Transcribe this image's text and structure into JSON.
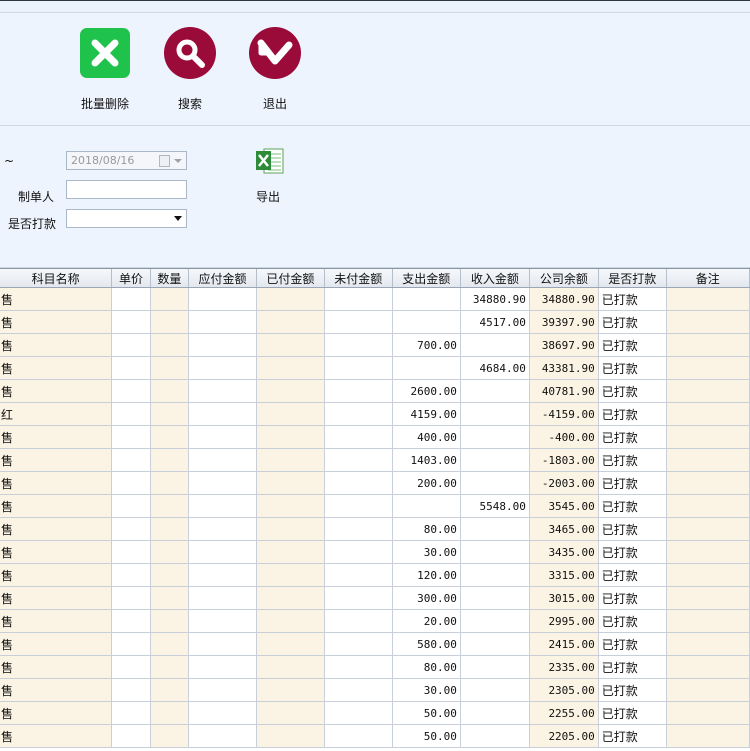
{
  "toolbar": {
    "batch_delete": "批量删除",
    "search": "搜索",
    "exit": "退出"
  },
  "form": {
    "tilde": "~",
    "date_value": "2018/08/16",
    "creator_label": "制单人",
    "creator_value": "",
    "paid_label": "是否打款",
    "paid_value": "",
    "export_label": "导出"
  },
  "grid": {
    "columns": [
      "科目名称",
      "单价",
      "数量",
      "应付金额",
      "已付金额",
      "未付金额",
      "支出金额",
      "收入金额",
      "公司余额",
      "是否打款",
      "备注"
    ],
    "rows": [
      {
        "subject": "售",
        "expense": "",
        "income": "34880.90",
        "balance": "34880.90",
        "paid": "已打款"
      },
      {
        "subject": "售",
        "expense": "",
        "income": "4517.00",
        "balance": "39397.90",
        "paid": "已打款"
      },
      {
        "subject": "售",
        "expense": "700.00",
        "income": "",
        "balance": "38697.90",
        "paid": "已打款"
      },
      {
        "subject": "售",
        "expense": "",
        "income": "4684.00",
        "balance": "43381.90",
        "paid": "已打款"
      },
      {
        "subject": "售",
        "expense": "2600.00",
        "income": "",
        "balance": "40781.90",
        "paid": "已打款"
      },
      {
        "subject": "红",
        "expense": "4159.00",
        "income": "",
        "balance": "-4159.00",
        "paid": "已打款"
      },
      {
        "subject": "售",
        "expense": "400.00",
        "income": "",
        "balance": "-400.00",
        "paid": "已打款"
      },
      {
        "subject": "售",
        "expense": "1403.00",
        "income": "",
        "balance": "-1803.00",
        "paid": "已打款"
      },
      {
        "subject": "售",
        "expense": "200.00",
        "income": "",
        "balance": "-2003.00",
        "paid": "已打款"
      },
      {
        "subject": "售",
        "expense": "",
        "income": "5548.00",
        "balance": "3545.00",
        "paid": "已打款"
      },
      {
        "subject": "售",
        "expense": "80.00",
        "income": "",
        "balance": "3465.00",
        "paid": "已打款"
      },
      {
        "subject": "售",
        "expense": "30.00",
        "income": "",
        "balance": "3435.00",
        "paid": "已打款"
      },
      {
        "subject": "售",
        "expense": "120.00",
        "income": "",
        "balance": "3315.00",
        "paid": "已打款"
      },
      {
        "subject": "售",
        "expense": "300.00",
        "income": "",
        "balance": "3015.00",
        "paid": "已打款"
      },
      {
        "subject": "售",
        "expense": "20.00",
        "income": "",
        "balance": "2995.00",
        "paid": "已打款"
      },
      {
        "subject": "售",
        "expense": "580.00",
        "income": "",
        "balance": "2415.00",
        "paid": "已打款"
      },
      {
        "subject": "售",
        "expense": "80.00",
        "income": "",
        "balance": "2335.00",
        "paid": "已打款"
      },
      {
        "subject": "售",
        "expense": "30.00",
        "income": "",
        "balance": "2305.00",
        "paid": "已打款"
      },
      {
        "subject": "售",
        "expense": "50.00",
        "income": "",
        "balance": "2255.00",
        "paid": "已打款"
      },
      {
        "subject": "售",
        "expense": "50.00",
        "income": "",
        "balance": "2205.00",
        "paid": "已打款"
      }
    ]
  },
  "colors": {
    "delete_green": "#1fc24a",
    "button_maroon": "#9a0b3a",
    "cell_tan": "#fbf4e4"
  },
  "icons": {
    "delete": "close-x-icon",
    "search": "magnifier-icon",
    "exit": "return-arrow-icon",
    "export": "excel-icon",
    "calendar": "calendar-icon"
  }
}
